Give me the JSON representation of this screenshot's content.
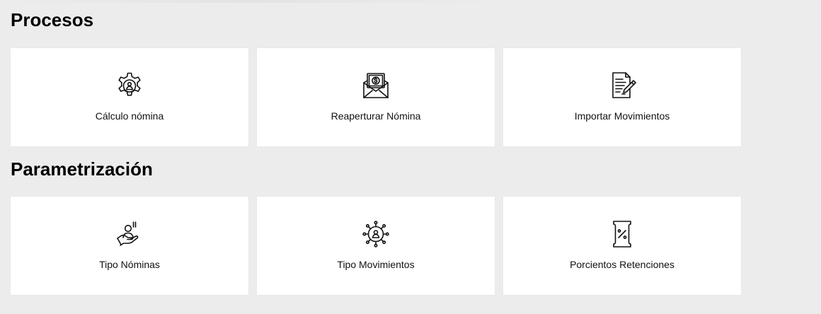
{
  "sections": [
    {
      "title": "Procesos",
      "cards": [
        {
          "label": "Cálculo nómina",
          "icon": "gear-user-icon"
        },
        {
          "label": "Reaperturar Nómina",
          "icon": "money-envelope-icon"
        },
        {
          "label": "Importar Movimientos",
          "icon": "document-pen-icon"
        }
      ]
    },
    {
      "title": "Parametrización",
      "cards": [
        {
          "label": "Tipo Nóminas",
          "icon": "hand-user-icon"
        },
        {
          "label": "Tipo Movimientos",
          "icon": "user-network-icon"
        },
        {
          "label": "Porcientos Retenciones",
          "icon": "percent-receipt-icon"
        }
      ]
    }
  ]
}
